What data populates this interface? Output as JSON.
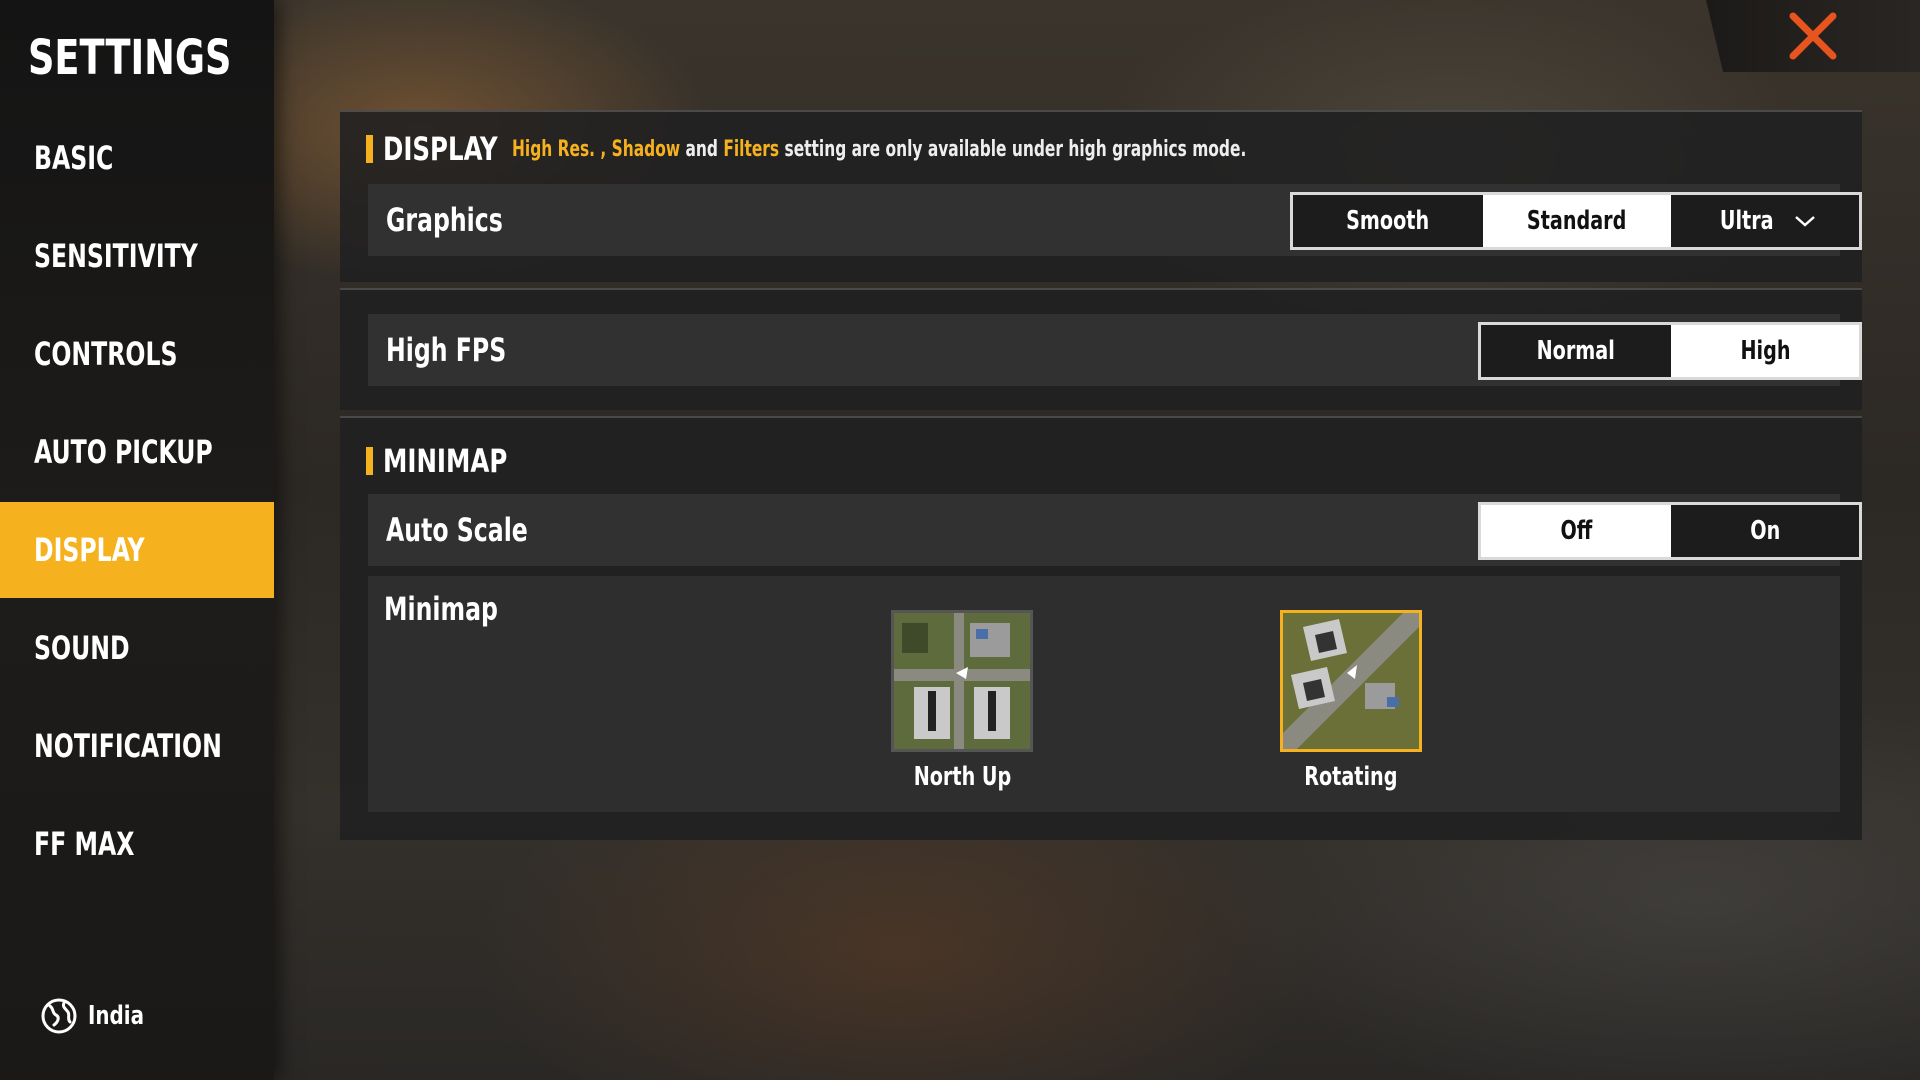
{
  "sidebar": {
    "title": "SETTINGS",
    "items": [
      {
        "label": "BASIC"
      },
      {
        "label": "SENSITIVITY"
      },
      {
        "label": "CONTROLS"
      },
      {
        "label": "AUTO PICKUP"
      },
      {
        "label": "DISPLAY",
        "active": true
      },
      {
        "label": "SOUND"
      },
      {
        "label": "NOTIFICATION"
      },
      {
        "label": "FF MAX"
      }
    ],
    "region": {
      "icon": "globe-icon",
      "label": "India"
    }
  },
  "close": {
    "icon": "close-icon",
    "color": "#e8541e"
  },
  "display": {
    "title": "DISPLAY",
    "note": {
      "hl1": "High Res. ,",
      "hl2": "Shadow",
      "and": "and",
      "hl3": "Filters",
      "rest": "setting are only available under high graphics mode."
    },
    "graphics": {
      "label": "Graphics",
      "options": [
        "Smooth",
        "Standard",
        "Ultra"
      ],
      "selected": "Standard"
    }
  },
  "fps": {
    "label": "High FPS",
    "options": [
      "Normal",
      "High"
    ],
    "selected": "High"
  },
  "minimap": {
    "title": "MINIMAP",
    "auto_scale": {
      "label": "Auto Scale",
      "options": [
        "Off",
        "On"
      ],
      "selected": "Off"
    },
    "minimap_mode": {
      "label": "Minimap",
      "options": [
        "North Up",
        "Rotating"
      ],
      "selected": "Rotating"
    }
  },
  "colors": {
    "accent": "#f5b21e",
    "close": "#e8541e"
  }
}
